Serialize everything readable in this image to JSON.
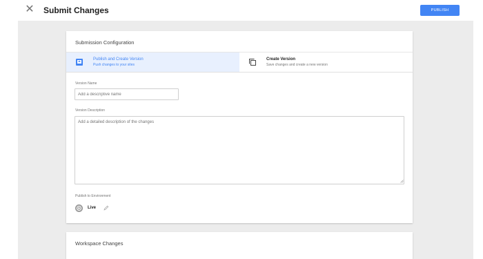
{
  "header": {
    "close_icon": "close-icon",
    "title": "Submit Changes",
    "publish_label": "PUBLISH",
    "publish_color": "#4285f4"
  },
  "config_card": {
    "title": "Submission Configuration",
    "options": [
      {
        "label": "Publish and Create Version",
        "sublabel": "Push changes to your sites",
        "icon": "publish-icon",
        "selected": true
      },
      {
        "label": "Create Version",
        "sublabel": "Save changes and create a new version",
        "icon": "copy-icon",
        "selected": false
      }
    ],
    "version_name": {
      "label": "Version Name",
      "value": "",
      "placeholder": "Add a descriptive name"
    },
    "version_description": {
      "label": "Version Description",
      "value": "",
      "placeholder": "Add a detailed description of the changes"
    },
    "environment": {
      "label": "Publish to Environment",
      "value": "Live",
      "icon": "environment-icon",
      "edit_icon": "pencil-icon"
    }
  },
  "workspace_card": {
    "title": "Workspace Changes"
  }
}
